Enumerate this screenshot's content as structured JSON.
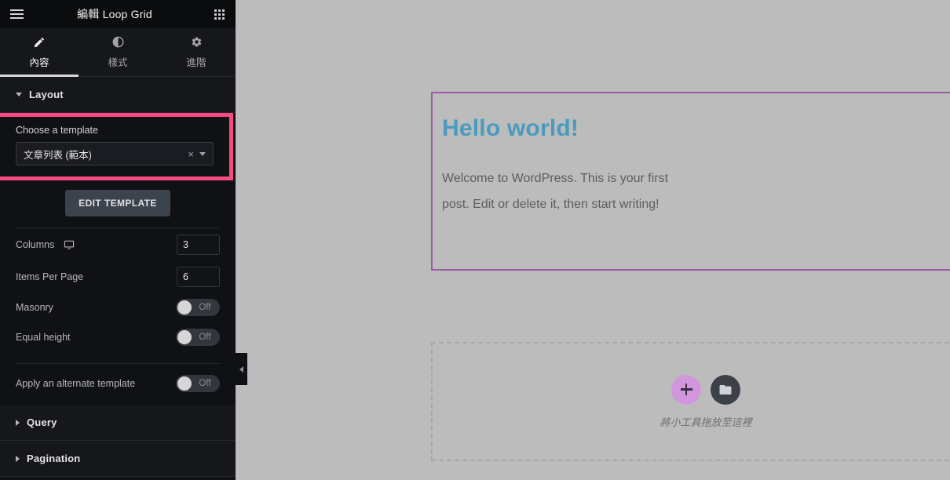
{
  "panel": {
    "header": {
      "title": "編輯 Loop Grid",
      "menu_icon": "hamburger-icon",
      "apps_icon": "grid-apps-icon"
    },
    "tabs": [
      {
        "label": "內容",
        "icon": "pencil-icon",
        "active": true
      },
      {
        "label": "樣式",
        "icon": "contrast-icon",
        "active": false
      },
      {
        "label": "進階",
        "icon": "gear-icon",
        "active": false
      }
    ],
    "sections": {
      "layout": {
        "title": "Layout",
        "expanded": true,
        "template_label": "Choose a template",
        "template_value": "文章列表 (範本)",
        "clear_glyph": "×",
        "edit_template_label": "EDIT TEMPLATE",
        "controls": [
          {
            "label": "Columns",
            "type": "number",
            "value": "3",
            "device_icon": "desktop-icon"
          },
          {
            "label": "Items Per Page",
            "type": "number",
            "value": "6"
          },
          {
            "label": "Masonry",
            "type": "toggle",
            "value": "Off"
          },
          {
            "label": "Equal height",
            "type": "toggle",
            "value": "Off"
          },
          {
            "label": "Apply an alternate template",
            "type": "toggle",
            "value": "Off"
          }
        ]
      },
      "query": {
        "title": "Query",
        "expanded": false
      },
      "pagination": {
        "title": "Pagination",
        "expanded": false
      }
    },
    "collapse_handle_icon": "chevron-left-icon",
    "highlight_color": "#fa4a80"
  },
  "canvas": {
    "post": {
      "title": "Hello world!",
      "title_color": "#4a9bbd",
      "border_color": "#9a5ba4",
      "lines": [
        "Welcome to WordPress. This is your first",
        "post. Edit or delete it, then start writing!"
      ]
    },
    "dropzone": {
      "add_icon": "plus-icon",
      "folder_icon": "folder-icon",
      "text": "將小工具拖放至這裡",
      "add_color": "#d296dd",
      "folder_color": "#3b4049"
    }
  }
}
